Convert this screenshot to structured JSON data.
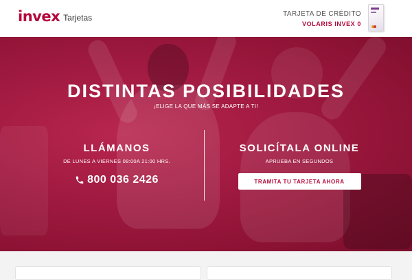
{
  "header": {
    "logo_text": "invex",
    "logo_subtitle": "Tarjetas",
    "promo_line1": "TARJETA DE CRÉDITO",
    "promo_line2": "VOLARIS INVEX 0",
    "brand_color": "#b5093b"
  },
  "hero": {
    "title": "DISTINTAS POSIBILIDADES",
    "subtitle": "¡ELIGE LA QUE MÁS SE ADAPTE A TI!",
    "call": {
      "title": "LLÁMANOS",
      "hours": "DE LUNES A VIERNES 08:00A 21:00 HRS.",
      "phone": "800 036 2426",
      "icon": "phone-icon"
    },
    "online": {
      "title": "SOLICÍTALA ONLINE",
      "subtitle": "APRUEBA EN SEGUNDOS",
      "button_label": "TRAMITA TU TARJETA AHORA"
    },
    "overlay_color": "#a11a41"
  }
}
